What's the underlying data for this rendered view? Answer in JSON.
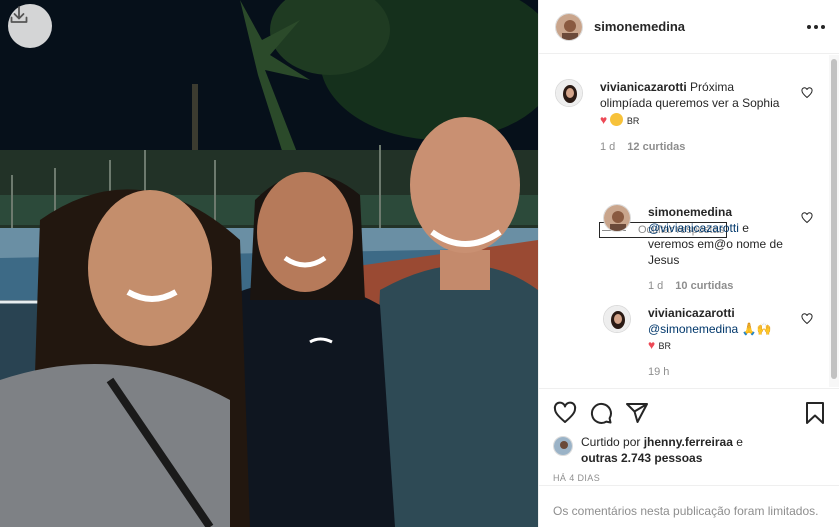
{
  "post": {
    "author": "simonemedina",
    "more_icon": "ellipsis-icon",
    "download_icon": "download-icon"
  },
  "comments": [
    {
      "username": "vivianicazarotti",
      "text": "Próxima olimpíada queremos ver a Sophia",
      "emoji_suffix": "BR",
      "time": "1 d",
      "likes": "12 curtidas"
    }
  ],
  "replies_toggle": "Ocultar respostas",
  "replies": [
    {
      "username": "simonemedina",
      "mention": "@vivianicazarotti",
      "text": "e veremos em@o nome de Jesus",
      "time": "1 d",
      "likes": "10 curtidas"
    },
    {
      "username": "vivianicazarotti",
      "mention": "@simonemedina",
      "emoji_suffix": "BR",
      "time": "19 h"
    }
  ],
  "liked_by": {
    "prefix": "Curtido por",
    "user": "jhenny.ferreiraa",
    "suffix": "e",
    "others": "outras 2.743 pessoas"
  },
  "time_ago": "HÁ 4 DIAS",
  "comments_limited": "Os comentários nesta publicação foram limitados.",
  "colors": {
    "heart": "#ed4956",
    "link": "#00376b",
    "muted": "#8e8e8e"
  }
}
